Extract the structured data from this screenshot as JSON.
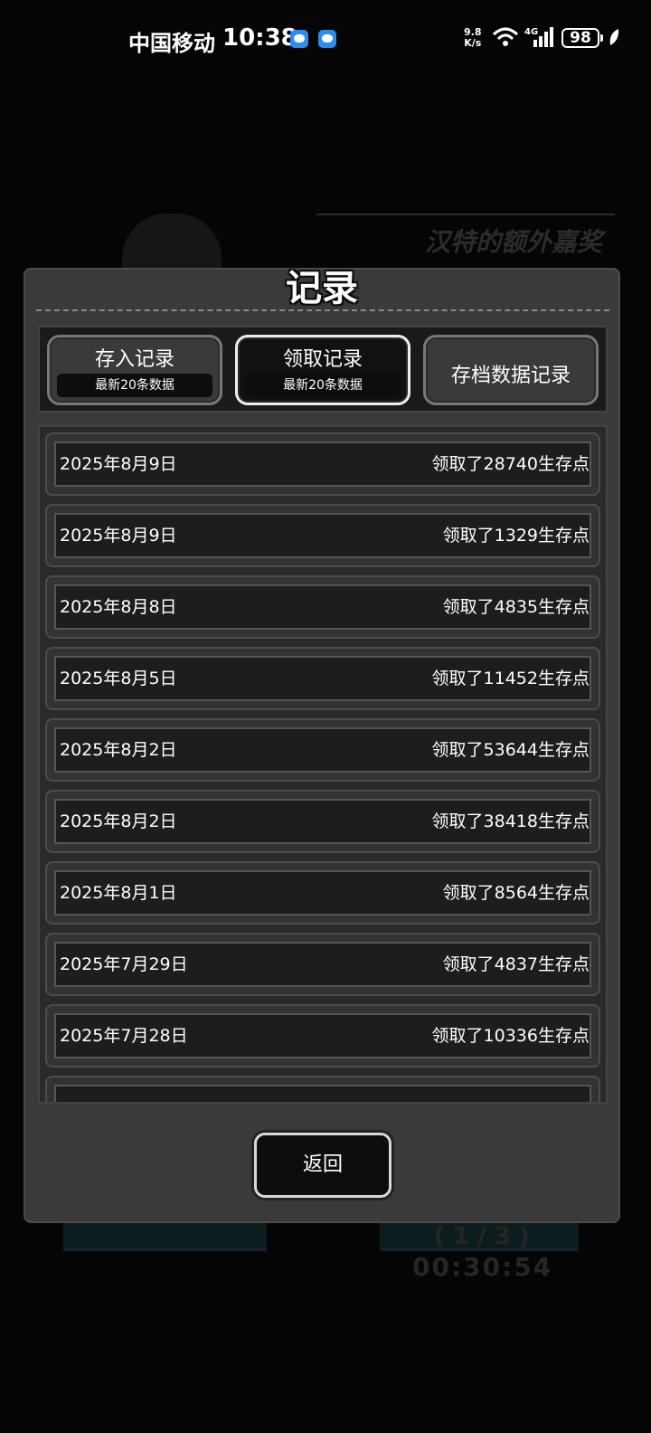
{
  "status_bar": {
    "carrier": "中国移动",
    "time": "10:38",
    "net_speed_value": "9.8",
    "net_speed_unit": "K/s",
    "network_type": "4G",
    "battery": "98"
  },
  "background": {
    "banner_text": "汉特的额外嘉奖",
    "progress": "( 1 / 3 )",
    "timer": "00:30:54"
  },
  "dialog": {
    "title": "记录",
    "tabs": [
      {
        "label": "存入记录",
        "sub": "最新20条数据"
      },
      {
        "label": "领取记录",
        "sub": "最新20条数据"
      },
      {
        "label": "存档数据记录"
      }
    ],
    "records": [
      {
        "date": "2025年8月9日",
        "text": "领取了28740生存点"
      },
      {
        "date": "2025年8月9日",
        "text": "领取了1329生存点"
      },
      {
        "date": "2025年8月8日",
        "text": "领取了4835生存点"
      },
      {
        "date": "2025年8月5日",
        "text": "领取了11452生存点"
      },
      {
        "date": "2025年8月2日",
        "text": "领取了53644生存点"
      },
      {
        "date": "2025年8月2日",
        "text": "领取了38418生存点"
      },
      {
        "date": "2025年8月1日",
        "text": "领取了8564生存点"
      },
      {
        "date": "2025年7月29日",
        "text": "领取了4837生存点"
      },
      {
        "date": "2025年7月28日",
        "text": "领取了10336生存点"
      }
    ],
    "back_label": "返回"
  }
}
